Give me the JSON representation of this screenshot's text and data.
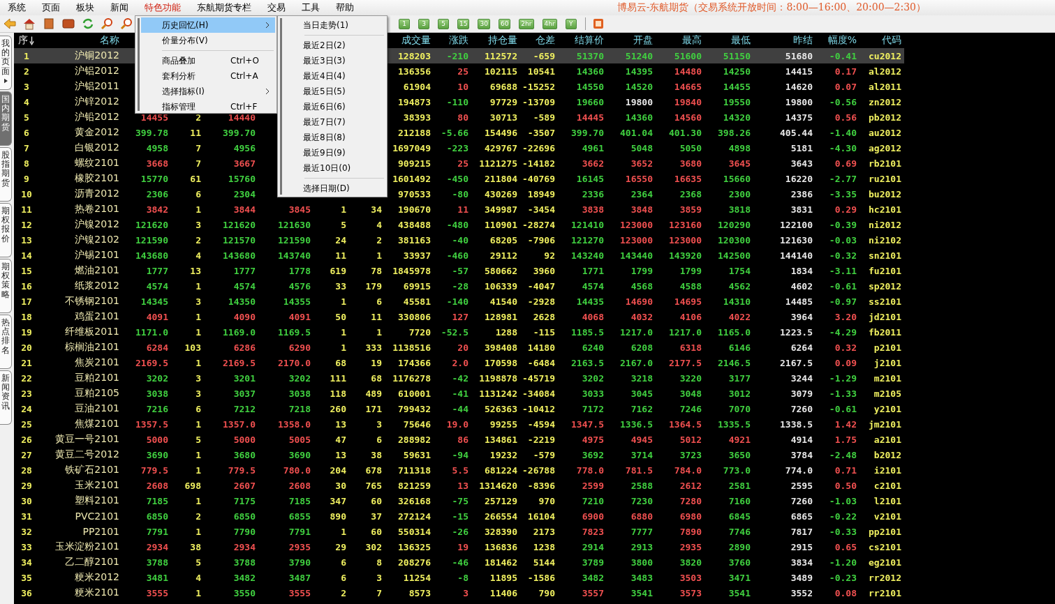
{
  "menubar": {
    "items": [
      {
        "label": "系统",
        "selected": false
      },
      {
        "label": "页面",
        "selected": false
      },
      {
        "label": "板块",
        "selected": false
      },
      {
        "label": "新闻",
        "selected": false
      },
      {
        "label": "特色功能",
        "selected": true
      },
      {
        "label": "东航期货专栏",
        "selected": false
      },
      {
        "label": "交易",
        "selected": false
      },
      {
        "label": "工具",
        "selected": false
      },
      {
        "label": "帮助",
        "selected": false
      }
    ],
    "title": "博易云-东航期货（交易系统开放时间：8:00—16:00、20:00—2:30）"
  },
  "toolbar": {
    "periods": [
      "1",
      "3",
      "5",
      "15",
      "30",
      "60",
      "2hr",
      "4hr",
      "Y"
    ]
  },
  "side_tabs": [
    {
      "label": "我的页面",
      "selected": false,
      "has_arrow": true
    },
    {
      "label": "国内期货",
      "selected": true,
      "has_arrow": false
    },
    {
      "label": "股指期货",
      "selected": false,
      "has_arrow": false
    },
    {
      "label": "期权报价",
      "selected": false,
      "has_arrow": false
    },
    {
      "label": "期权策略",
      "selected": false,
      "has_arrow": false
    },
    {
      "label": "热点排名",
      "selected": false,
      "has_arrow": false
    },
    {
      "label": "新闻资讯",
      "selected": false,
      "has_arrow": false
    }
  ],
  "table": {
    "columns": [
      {
        "header": "序",
        "kind": "index",
        "sorted": true
      },
      {
        "header": "名称",
        "kind": "name",
        "sorted": false
      },
      {
        "kind": "price"
      },
      {
        "kind": "volume"
      },
      {
        "kind": "price"
      },
      {
        "kind": "price"
      },
      {
        "kind": "volume"
      },
      {
        "kind": "volume"
      },
      {
        "header": "成交量",
        "kind": "volume",
        "sorted": false
      },
      {
        "header": "涨跌",
        "kind": "change",
        "sorted": false
      },
      {
        "header": "持仓量",
        "kind": "volume",
        "sorted": false
      },
      {
        "header": "仓差",
        "kind": "volume",
        "sorted": false
      },
      {
        "header": "结算价",
        "kind": "price",
        "sorted": false
      },
      {
        "header": "开盘",
        "kind": "price",
        "sorted": false
      },
      {
        "header": "最高",
        "kind": "price",
        "sorted": false
      },
      {
        "header": "最低",
        "kind": "price",
        "sorted": false
      },
      {
        "header": "昨结",
        "kind": "prev",
        "sorted": false
      },
      {
        "header": "幅度%",
        "kind": "change",
        "sorted": false
      },
      {
        "header": "代码",
        "kind": "code",
        "sorted": false
      }
    ],
    "rows": [
      {
        "selected": true,
        "cells": [
          "1",
          "沪铜2012",
          null,
          null,
          null,
          null,
          null,
          null,
          "128203",
          "-210",
          "112572",
          "-659",
          "51370",
          "51240",
          "51600",
          "51150",
          "51680",
          "-0.41",
          "cu2012"
        ]
      },
      {
        "selected": false,
        "cells": [
          "2",
          "沪铝2012",
          null,
          null,
          null,
          null,
          null,
          null,
          "136356",
          "25",
          "102115",
          "10541",
          "14360",
          "14395",
          "14480",
          "14250",
          "14415",
          "0.17",
          "al2012"
        ]
      },
      {
        "selected": false,
        "cells": [
          "3",
          "沪铝2011",
          null,
          null,
          null,
          null,
          null,
          null,
          "61904",
          "10",
          "69688",
          "-15252",
          "14550",
          "14520",
          "14665",
          "14455",
          "14620",
          "0.07",
          "al2011"
        ]
      },
      {
        "selected": false,
        "cells": [
          "4",
          "沪锌2012",
          null,
          null,
          null,
          null,
          null,
          null,
          "194873",
          "-110",
          "97729",
          "-13709",
          "19660",
          "19800",
          "19840",
          "19550",
          "19800",
          "-0.56",
          "zn2012"
        ]
      },
      {
        "selected": false,
        "cells": [
          "5",
          "沪铅2012",
          "14455",
          "2",
          "14440",
          null,
          null,
          null,
          "38393",
          "80",
          "30713",
          "-589",
          "14445",
          "14360",
          "14560",
          "14320",
          "14375",
          "0.56",
          "pb2012"
        ]
      },
      {
        "selected": false,
        "cells": [
          "6",
          "黄金2012",
          "399.78",
          "11",
          "399.70",
          null,
          null,
          null,
          "212188",
          "-5.66",
          "154496",
          "-3507",
          "399.70",
          "401.04",
          "401.30",
          "398.26",
          "405.44",
          "-1.40",
          "au2012"
        ]
      },
      {
        "selected": false,
        "cells": [
          "7",
          "白银2012",
          "4958",
          "7",
          "4956",
          null,
          null,
          null,
          "1697049",
          "-223",
          "429767",
          "-22696",
          "4961",
          "5048",
          "5050",
          "4898",
          "5181",
          "-4.30",
          "ag2012"
        ]
      },
      {
        "selected": false,
        "cells": [
          "8",
          "螺纹2101",
          "3668",
          "7",
          "3667",
          null,
          null,
          null,
          "909215",
          "25",
          "1121275",
          "-14182",
          "3662",
          "3652",
          "3680",
          "3645",
          "3643",
          "0.69",
          "rb2101"
        ]
      },
      {
        "selected": false,
        "cells": [
          "9",
          "橡胶2101",
          "15770",
          "61",
          "15760",
          null,
          null,
          null,
          "1601492",
          "-450",
          "211804",
          "-40769",
          "16145",
          "16550",
          "16635",
          "15660",
          "16220",
          "-2.77",
          "ru2101"
        ]
      },
      {
        "selected": false,
        "cells": [
          "10",
          "沥青2012",
          "2306",
          "6",
          "2304",
          null,
          null,
          null,
          "970533",
          "-80",
          "430269",
          "18949",
          "2336",
          "2364",
          "2368",
          "2300",
          "2386",
          "-3.35",
          "bu2012"
        ]
      },
      {
        "selected": false,
        "cells": [
          "11",
          "热卷2101",
          "3842",
          "1",
          "3844",
          "3845",
          "1",
          "34",
          "190670",
          "11",
          "349987",
          "-3454",
          "3838",
          "3848",
          "3859",
          "3818",
          "3831",
          "0.29",
          "hc2101"
        ]
      },
      {
        "selected": false,
        "cells": [
          "12",
          "沪镍2012",
          "121620",
          "3",
          "121620",
          "121630",
          "5",
          "4",
          "438488",
          "-480",
          "110901",
          "-28274",
          "121410",
          "123000",
          "123160",
          "120290",
          "122100",
          "-0.39",
          "ni2012"
        ]
      },
      {
        "selected": false,
        "cells": [
          "13",
          "沪镍2102",
          "121590",
          "2",
          "121570",
          "121590",
          "24",
          "2",
          "381163",
          "-40",
          "68205",
          "-7906",
          "121270",
          "123000",
          "123000",
          "120300",
          "121630",
          "-0.03",
          "ni2102"
        ]
      },
      {
        "selected": false,
        "cells": [
          "14",
          "沪锡2101",
          "143680",
          "4",
          "143680",
          "143740",
          "11",
          "1",
          "33937",
          "-460",
          "29112",
          "92",
          "143240",
          "143440",
          "143920",
          "142500",
          "144140",
          "-0.32",
          "sn2101"
        ]
      },
      {
        "selected": false,
        "cells": [
          "15",
          "燃油2101",
          "1777",
          "13",
          "1777",
          "1778",
          "619",
          "78",
          "1845978",
          "-57",
          "580662",
          "3960",
          "1771",
          "1799",
          "1799",
          "1754",
          "1834",
          "-3.11",
          "fu2101"
        ]
      },
      {
        "selected": false,
        "cells": [
          "16",
          "纸浆2012",
          "4574",
          "1",
          "4574",
          "4576",
          "33",
          "179",
          "69915",
          "-28",
          "106339",
          "-4047",
          "4574",
          "4568",
          "4588",
          "4562",
          "4602",
          "-0.61",
          "sp2012"
        ]
      },
      {
        "selected": false,
        "cells": [
          "17",
          "不锈钢2101",
          "14345",
          "3",
          "14350",
          "14355",
          "1",
          "6",
          "45581",
          "-140",
          "41540",
          "-2928",
          "14435",
          "14690",
          "14695",
          "14310",
          "14485",
          "-0.97",
          "ss2101"
        ]
      },
      {
        "selected": false,
        "cells": [
          "18",
          "鸡蛋2101",
          "4091",
          "1",
          "4090",
          "4091",
          "50",
          "11",
          "330806",
          "127",
          "128981",
          "2628",
          "4068",
          "4032",
          "4106",
          "4022",
          "3964",
          "3.20",
          "jd2101"
        ]
      },
      {
        "selected": false,
        "cells": [
          "19",
          "纤维板2011",
          "1171.0",
          "1",
          "1169.0",
          "1169.5",
          "1",
          "1",
          "7720",
          "-52.5",
          "1288",
          "-115",
          "1185.5",
          "1217.0",
          "1217.0",
          "1165.0",
          "1223.5",
          "-4.29",
          "fb2011"
        ]
      },
      {
        "selected": false,
        "cells": [
          "20",
          "棕榈油2101",
          "6284",
          "103",
          "6286",
          "6290",
          "1",
          "333",
          "1138516",
          "20",
          "398408",
          "14180",
          "6240",
          "6208",
          "6318",
          "6146",
          "6264",
          "0.32",
          "p2101"
        ]
      },
      {
        "selected": false,
        "cells": [
          "21",
          "焦炭2101",
          "2169.5",
          "1",
          "2169.5",
          "2170.0",
          "68",
          "19",
          "174366",
          "2.0",
          "170598",
          "-6484",
          "2163.5",
          "2167.0",
          "2177.5",
          "2146.5",
          "2167.5",
          "0.09",
          "j2101"
        ]
      },
      {
        "selected": false,
        "cells": [
          "22",
          "豆粕2101",
          "3202",
          "3",
          "3201",
          "3202",
          "111",
          "68",
          "1176278",
          "-42",
          "1198878",
          "-45719",
          "3202",
          "3218",
          "3220",
          "3177",
          "3244",
          "-1.29",
          "m2101"
        ]
      },
      {
        "selected": false,
        "cells": [
          "23",
          "豆粕2105",
          "3038",
          "3",
          "3037",
          "3038",
          "118",
          "489",
          "610001",
          "-41",
          "1131242",
          "-34084",
          "3033",
          "3045",
          "3048",
          "3012",
          "3079",
          "-1.33",
          "m2105"
        ]
      },
      {
        "selected": false,
        "cells": [
          "24",
          "豆油2101",
          "7216",
          "6",
          "7212",
          "7218",
          "260",
          "171",
          "799432",
          "-44",
          "526363",
          "-10412",
          "7172",
          "7162",
          "7246",
          "7070",
          "7260",
          "-0.61",
          "y2101"
        ]
      },
      {
        "selected": false,
        "cells": [
          "25",
          "焦煤2101",
          "1357.5",
          "1",
          "1357.0",
          "1358.0",
          "13",
          "3",
          "75646",
          "19.0",
          "99255",
          "-4594",
          "1347.5",
          "1336.5",
          "1364.5",
          "1335.5",
          "1338.5",
          "1.42",
          "jm2101"
        ]
      },
      {
        "selected": false,
        "cells": [
          "26",
          "黄豆一号2101",
          "5000",
          "5",
          "5000",
          "5005",
          "47",
          "6",
          "288982",
          "86",
          "134861",
          "-2219",
          "4975",
          "4945",
          "5012",
          "4921",
          "4914",
          "1.75",
          "a2101"
        ]
      },
      {
        "selected": false,
        "cells": [
          "27",
          "黄豆二号2012",
          "3690",
          "1",
          "3680",
          "3690",
          "13",
          "38",
          "59631",
          "-94",
          "19232",
          "-579",
          "3692",
          "3714",
          "3723",
          "3650",
          "3784",
          "-2.48",
          "b2012"
        ]
      },
      {
        "selected": false,
        "cells": [
          "28",
          "铁矿石2101",
          "779.5",
          "1",
          "779.5",
          "780.0",
          "204",
          "678",
          "711318",
          "5.5",
          "681224",
          "-26788",
          "778.0",
          "781.5",
          "784.0",
          "773.0",
          "774.0",
          "0.71",
          "i2101"
        ]
      },
      {
        "selected": false,
        "cells": [
          "29",
          "玉米2101",
          "2608",
          "698",
          "2607",
          "2608",
          "30",
          "765",
          "821259",
          "13",
          "1314620",
          "-8396",
          "2599",
          "2588",
          "2612",
          "2581",
          "2595",
          "0.50",
          "c2101"
        ]
      },
      {
        "selected": false,
        "cells": [
          "30",
          "塑料2101",
          "7185",
          "1",
          "7175",
          "7185",
          "347",
          "60",
          "326168",
          "-75",
          "257129",
          "970",
          "7210",
          "7230",
          "7280",
          "7160",
          "7260",
          "-1.03",
          "l2101"
        ]
      },
      {
        "selected": false,
        "cells": [
          "31",
          "PVC2101",
          "6850",
          "2",
          "6850",
          "6855",
          "890",
          "37",
          "272124",
          "-15",
          "266554",
          "16104",
          "6900",
          "6880",
          "6980",
          "6845",
          "6865",
          "-0.22",
          "v2101"
        ]
      },
      {
        "selected": false,
        "cells": [
          "32",
          "PP2101",
          "7791",
          "1",
          "7790",
          "7791",
          "1",
          "60",
          "550314",
          "-26",
          "328390",
          "2173",
          "7823",
          "7777",
          "7890",
          "7746",
          "7817",
          "-0.33",
          "pp2101"
        ]
      },
      {
        "selected": false,
        "cells": [
          "33",
          "玉米淀粉2101",
          "2934",
          "38",
          "2934",
          "2935",
          "29",
          "302",
          "136325",
          "19",
          "136836",
          "1238",
          "2914",
          "2913",
          "2935",
          "2890",
          "2915",
          "0.65",
          "cs2101"
        ]
      },
      {
        "selected": false,
        "cells": [
          "34",
          "乙二醇2101",
          "3788",
          "5",
          "3788",
          "3790",
          "6",
          "8",
          "208276",
          "-46",
          "181462",
          "5144",
          "3789",
          "3800",
          "3820",
          "3760",
          "3834",
          "-1.20",
          "eg2101"
        ]
      },
      {
        "selected": false,
        "cells": [
          "35",
          "粳米2012",
          "3481",
          "4",
          "3482",
          "3487",
          "6",
          "3",
          "11254",
          "-8",
          "11895",
          "-1586",
          "3482",
          "3483",
          "3503",
          "3471",
          "3489",
          "-0.23",
          "rr2012"
        ]
      },
      {
        "selected": false,
        "cells": [
          "36",
          "粳米2101",
          "3555",
          "1",
          "3550",
          "3555",
          "2",
          "7",
          "8573",
          "3",
          "11406",
          "790",
          "3557",
          "3541",
          "3573",
          "3541",
          "3552",
          "0.08",
          "rr2101"
        ]
      }
    ]
  },
  "menu": {
    "items": [
      {
        "kind": "item",
        "label": "历史回忆(H)",
        "has_submenu": true,
        "selected": true
      },
      {
        "kind": "item",
        "label": "价量分布(V)",
        "has_submenu": false,
        "selected": false
      },
      {
        "kind": "separator"
      },
      {
        "kind": "item",
        "label": "商品叠加",
        "shortcut": "Ctrl+O",
        "has_submenu": false,
        "selected": false
      },
      {
        "kind": "item",
        "label": "套利分析",
        "shortcut": "Ctrl+A",
        "has_submenu": false,
        "selected": false
      },
      {
        "kind": "item",
        "label": "选择指标(I)",
        "has_submenu": true,
        "selected": false
      },
      {
        "kind": "item",
        "label": "指标管理",
        "shortcut": "Ctrl+F",
        "has_submenu": false,
        "selected": false
      }
    ]
  },
  "submenu": {
    "items": [
      {
        "kind": "item",
        "label": "当日走势(1)"
      },
      {
        "kind": "separator"
      },
      {
        "kind": "item",
        "label": "最近2日(2)"
      },
      {
        "kind": "item",
        "label": "最近3日(3)"
      },
      {
        "kind": "item",
        "label": "最近4日(4)"
      },
      {
        "kind": "item",
        "label": "最近5日(5)"
      },
      {
        "kind": "item",
        "label": "最近6日(6)"
      },
      {
        "kind": "item",
        "label": "最近7日(7)"
      },
      {
        "kind": "item",
        "label": "最近8日(8)"
      },
      {
        "kind": "item",
        "label": "最近9日(9)"
      },
      {
        "kind": "item",
        "label": "最近10日(0)"
      },
      {
        "kind": "separator"
      },
      {
        "kind": "item",
        "label": "选择日期(D)"
      }
    ]
  }
}
